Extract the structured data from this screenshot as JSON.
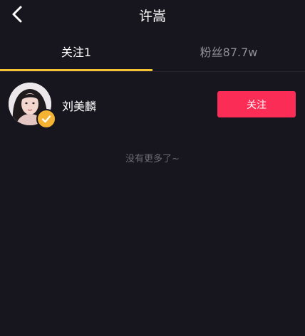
{
  "header": {
    "title": "许嵩",
    "back_icon": "chevron-left-icon"
  },
  "tabs": [
    {
      "label": "关注1",
      "active": true
    },
    {
      "label": "粉丝87.7w",
      "active": false
    }
  ],
  "colors": {
    "background": "#17161f",
    "tab_indicator": "#f5c135",
    "follow_button": "#fb2c55",
    "verified_badge": "#f4b332"
  },
  "list": {
    "items": [
      {
        "name": "刘美麟",
        "verified": true,
        "avatar_icon": "avatar",
        "badge_icon": "verified-check-icon",
        "action_label": "关注"
      }
    ],
    "end_note": "没有更多了~"
  }
}
